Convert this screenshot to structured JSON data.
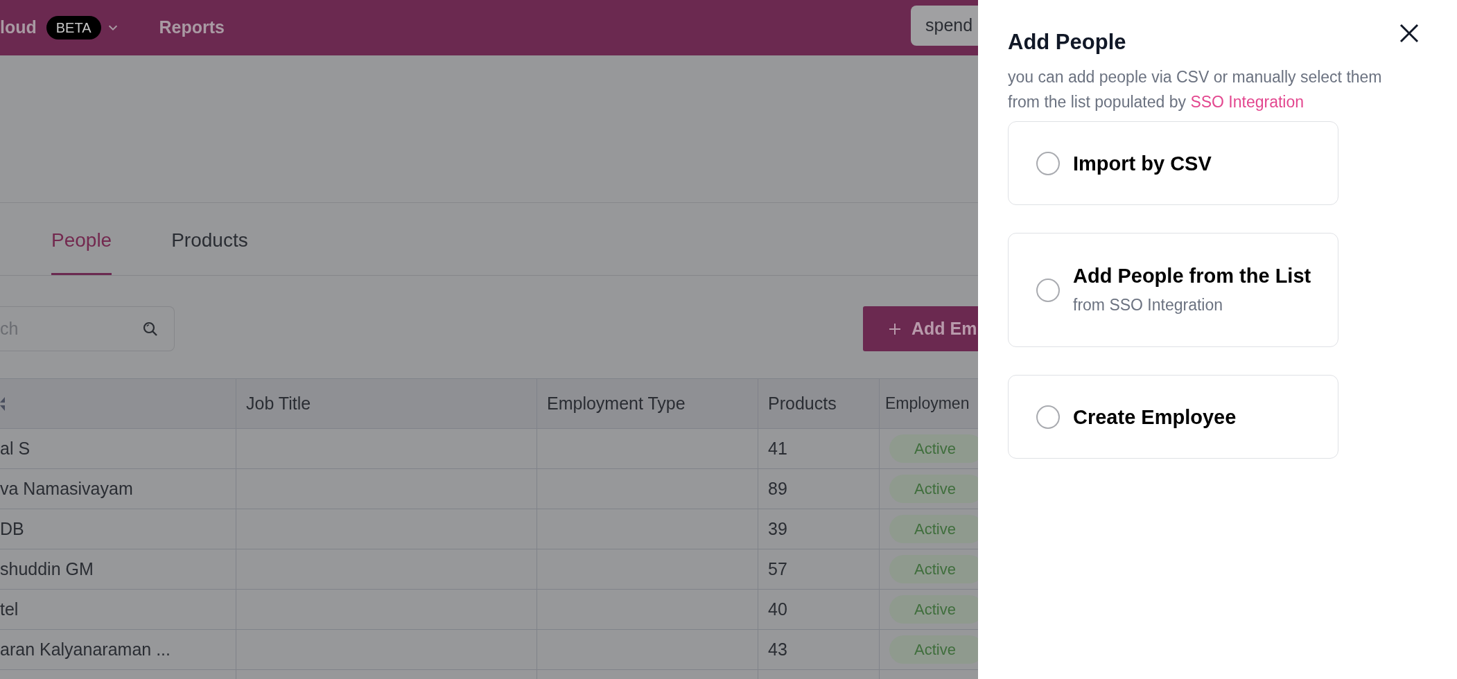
{
  "nav": {
    "brand": "loud",
    "badge": "BETA",
    "items": [
      "Reports"
    ],
    "search_value": "spend"
  },
  "tabs": [
    {
      "label": "People",
      "selected": true
    },
    {
      "label": "Products",
      "selected": false
    }
  ],
  "search": {
    "placeholder": "ch"
  },
  "add_button": {
    "label": "Add Em"
  },
  "table": {
    "columns": [
      "Job Title",
      "Employment Type",
      "Products",
      "Employmen"
    ],
    "rows": [
      {
        "name": "al S",
        "products": "41",
        "status": "Active"
      },
      {
        "name": "va Namasivayam",
        "products": "89",
        "status": "Active"
      },
      {
        "name": "DB",
        "products": "39",
        "status": "Active"
      },
      {
        "name": "shuddin GM",
        "products": "57",
        "status": "Active"
      },
      {
        "name": "tel",
        "products": "40",
        "status": "Active"
      },
      {
        "name": "aran Kalyanaraman ...",
        "products": "43",
        "status": "Active"
      }
    ]
  },
  "panel": {
    "title": "Add People",
    "description": "you can add people via CSV or manually select them from the list populated by",
    "link": "SSO Integration",
    "options": [
      {
        "label": "Import by CSV",
        "selected": false
      },
      {
        "label": "Add People from the List",
        "sublabel": "from SSO Integration",
        "selected": false
      },
      {
        "label": "Create Employee",
        "selected": false
      }
    ]
  }
}
